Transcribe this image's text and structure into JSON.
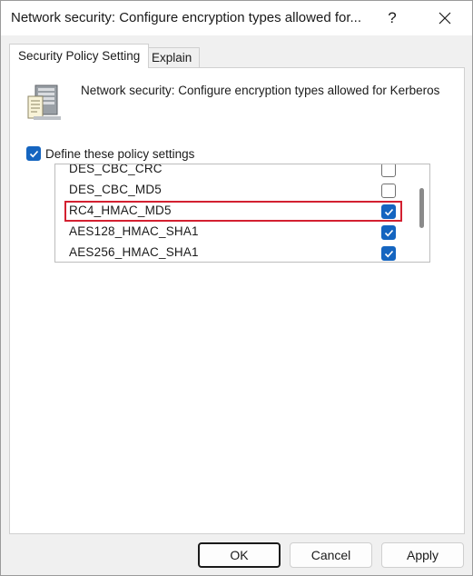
{
  "window": {
    "title": "Network security: Configure encryption types allowed for...",
    "help_label": "?"
  },
  "tabs": [
    {
      "label": "Security Policy Setting",
      "active": true
    },
    {
      "label": "Explain",
      "active": false
    }
  ],
  "policy": {
    "icon": "server-policy-icon",
    "name": "Network security: Configure encryption types allowed for Kerberos"
  },
  "define": {
    "label": "Define these policy settings",
    "checked": true
  },
  "encryption_types": [
    {
      "label": "DES_CBC_CRC",
      "checked": false,
      "highlighted": false
    },
    {
      "label": "DES_CBC_MD5",
      "checked": false,
      "highlighted": false
    },
    {
      "label": "RC4_HMAC_MD5",
      "checked": true,
      "highlighted": true
    },
    {
      "label": "AES128_HMAC_SHA1",
      "checked": true,
      "highlighted": false
    },
    {
      "label": "AES256_HMAC_SHA1",
      "checked": true,
      "highlighted": false
    }
  ],
  "buttons": {
    "ok": "OK",
    "cancel": "Cancel",
    "apply": "Apply"
  },
  "colors": {
    "accent": "#1565c0",
    "highlight": "#d32030"
  }
}
